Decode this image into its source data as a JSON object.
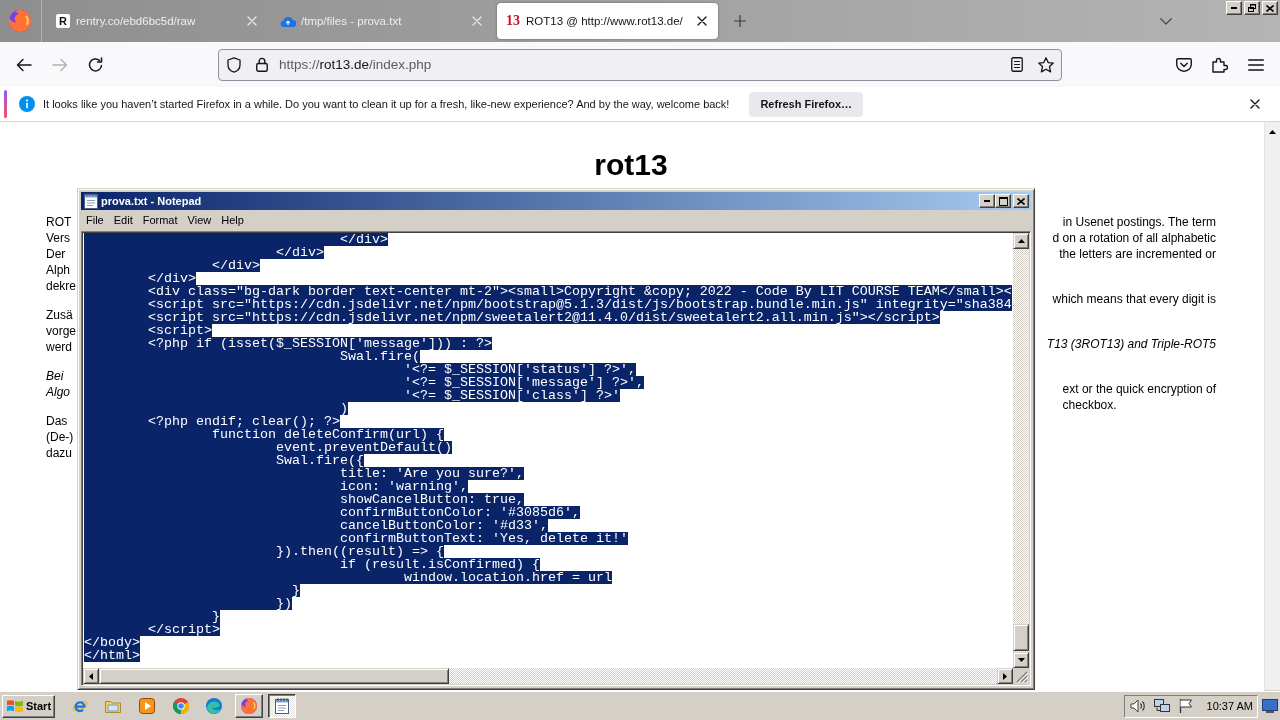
{
  "browser": {
    "tabs": [
      {
        "title": "rentry.co/ebd6bc5d/raw",
        "icon_text": "R",
        "selected": false
      },
      {
        "title": "/tmp/files - prova.txt",
        "selected": false
      },
      {
        "title": "ROT13 @ http://www.rot13.de/",
        "icon_text": "13",
        "selected": true
      }
    ],
    "back": {
      "disabled": false
    },
    "forward": {
      "disabled": true
    },
    "address": {
      "scheme": "https://",
      "host": "rot13.de",
      "path": "/index.php"
    },
    "notification": {
      "message": "It looks like you haven’t started Firefox in a while. Do you want to clean it up for a fresh, like-new experience? And by the way, welcome back!",
      "button": "Refresh Firefox…"
    }
  },
  "page": {
    "heading": "rot13",
    "left_column": [
      {
        "italic": false,
        "lines": [
          "ROT",
          "Vers",
          "Der",
          "Alph",
          "dekre"
        ]
      },
      {
        "italic": false,
        "lines": [
          "Zusä",
          "vorge",
          "werd"
        ]
      },
      {
        "italic": true,
        "lines": [
          "Bei",
          "Algo"
        ]
      },
      {
        "italic": false,
        "lines": [
          "Das",
          "(De-)",
          "dazu"
        ]
      }
    ],
    "right_column": [
      {
        "italic": false,
        "lines": [
          "in Usenet postings. The term",
          "d on a rotation of all alphabetic",
          "the letters are incremented or"
        ]
      },
      {
        "italic": false,
        "lines": [
          "which means that every digit is"
        ]
      },
      {
        "italic": true,
        "lines": [
          "T13 (3ROT13) and Triple-ROT5"
        ]
      },
      {
        "italic": false,
        "lines": [
          "ext or the quick encryption of",
          "checkbox."
        ]
      }
    ]
  },
  "notepad": {
    "title": "prova.txt - Notepad",
    "menu": [
      "File",
      "Edit",
      "Format",
      "View",
      "Help"
    ],
    "all_selected": true,
    "lines": [
      "\t\t\t\t</div>",
      "\t\t\t</div>",
      "\t\t</div>",
      "\t</div>",
      "\t<div class=\"bg-dark border text-center mt-2\"><small>Copyright &copy; 2022 - Code By LIT COURSE TEAM</small><",
      "\t<script src=\"https://cdn.jsdelivr.net/npm/bootstrap@5.1.3/dist/js/bootstrap.bundle.min.js\" integrity=\"sha384",
      "\t<script src=\"https://cdn.jsdelivr.net/npm/sweetalert2@11.4.0/dist/sweetalert2.all.min.js\"></script>",
      "\t<script>",
      "\t<?php if (isset($_SESSION['message'])) : ?>",
      "\t\t\t\tSwal.fire(",
      "\t\t\t\t\t'<?= $_SESSION['status'] ?>',",
      "\t\t\t\t\t'<?= $_SESSION['message'] ?>',",
      "\t\t\t\t\t'<?= $_SESSION['class'] ?>'",
      "\t\t\t\t)",
      "\t<?php endif; clear(); ?>",
      "\t\tfunction deleteConfirm(url) {",
      "\t\t\tevent.preventDefault()",
      "\t\t\tSwal.fire({",
      "\t\t\t\ttitle: 'Are you sure?',",
      "\t\t\t\ticon: 'warning',",
      "\t\t\t\tshowCancelButton: true,",
      "\t\t\t\tconfirmButtonColor: '#3085d6',",
      "\t\t\t\tcancelButtonColor: '#d33',",
      "\t\t\t\tconfirmButtonText: 'Yes, delete it!'",
      "\t\t\t}).then((result) => {",
      "\t\t\t\tif (result.isConfirmed) {",
      "\t\t\t\t\twindow.location.href = url",
      "\t\t\t  }",
      "\t\t\t})",
      "\t\t}",
      "\t</script>",
      "</body>",
      "</html>"
    ]
  },
  "taskbar": {
    "start": "Start",
    "tasks": [
      {
        "selected": false
      },
      {
        "selected": true
      }
    ],
    "clock": "10:37 AM"
  }
}
